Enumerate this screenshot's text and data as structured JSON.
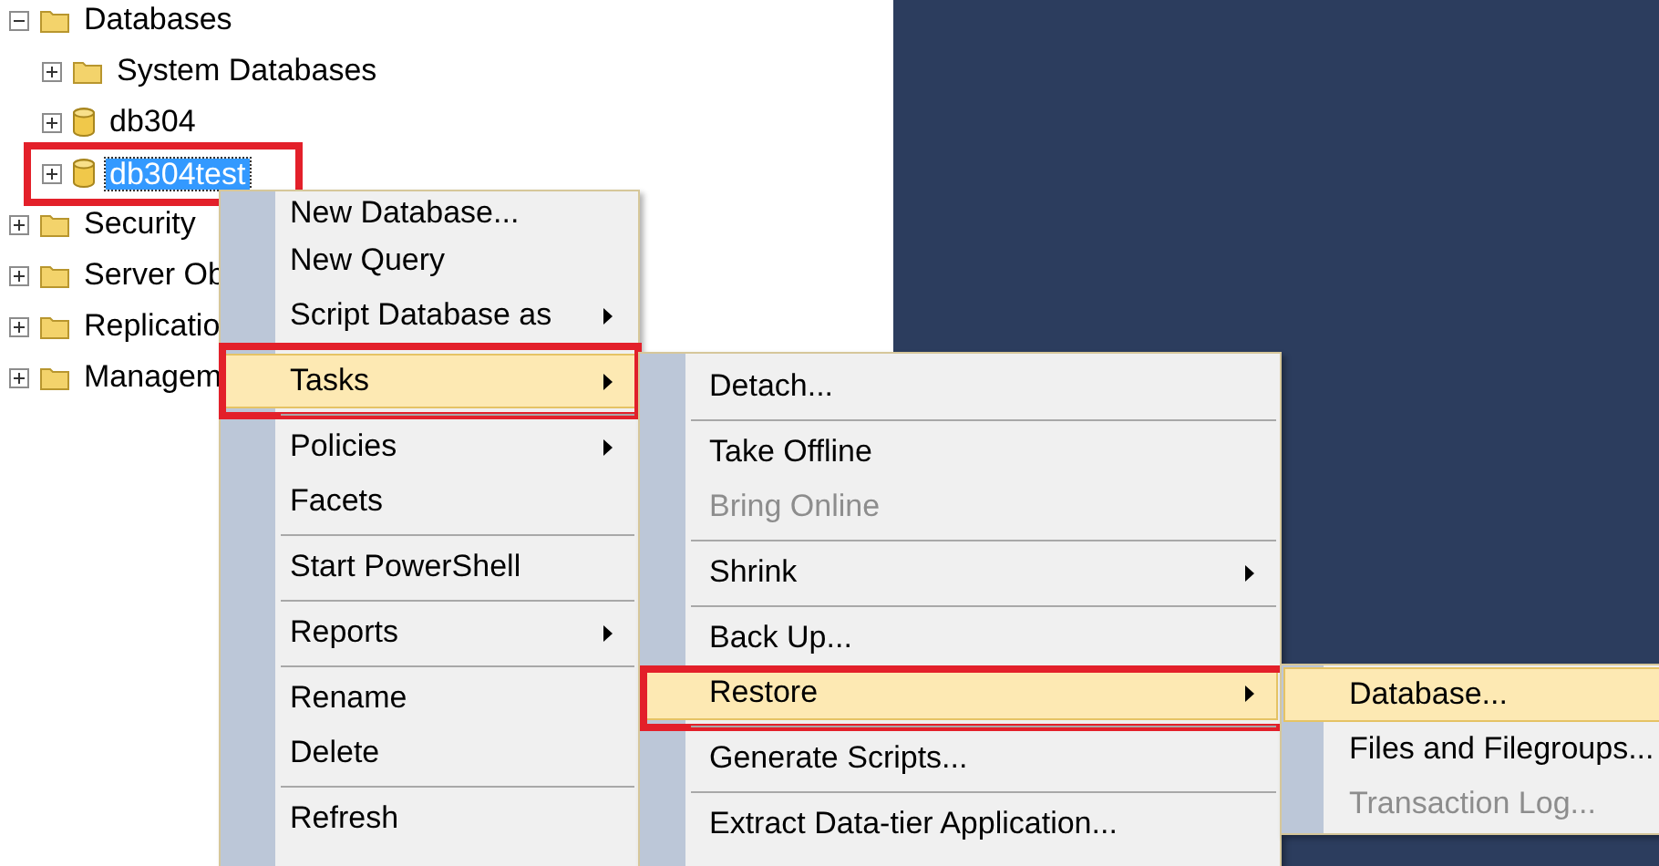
{
  "tree": [
    {
      "label": "Databases",
      "kind": "folder",
      "expanded": true,
      "selected": false,
      "annotated": false,
      "children": [
        {
          "label": "System Databases",
          "kind": "folder",
          "expanded": false,
          "selected": false,
          "annotated": false
        },
        {
          "label": "db304",
          "kind": "database",
          "expanded": false,
          "selected": false,
          "annotated": false
        },
        {
          "label": "db304test",
          "kind": "database",
          "expanded": false,
          "selected": true,
          "annotated": true
        }
      ]
    },
    {
      "label": "Security",
      "kind": "folder",
      "expanded": false,
      "selected": false,
      "annotated": false
    },
    {
      "label": "Server Ob",
      "kind": "folder",
      "expanded": false,
      "selected": false,
      "annotated": false
    },
    {
      "label": "Replicatio",
      "kind": "folder",
      "expanded": false,
      "selected": false,
      "annotated": false
    },
    {
      "label": "Managem",
      "kind": "folder",
      "expanded": false,
      "selected": false,
      "annotated": false
    }
  ],
  "menus": [
    {
      "items": [
        {
          "kind": "item",
          "label": "New Database...",
          "submenu": false,
          "selected": false,
          "disabled": false,
          "annotated": false
        },
        {
          "kind": "item",
          "label": "New Query",
          "submenu": false,
          "selected": false,
          "disabled": false,
          "annotated": false
        },
        {
          "kind": "item",
          "label": "Script Database as",
          "submenu": true,
          "selected": false,
          "disabled": false,
          "annotated": false
        },
        {
          "kind": "separator"
        },
        {
          "kind": "item",
          "label": "Tasks",
          "submenu": true,
          "selected": true,
          "disabled": false,
          "annotated": true
        },
        {
          "kind": "separator"
        },
        {
          "kind": "item",
          "label": "Policies",
          "submenu": true,
          "selected": false,
          "disabled": false,
          "annotated": false
        },
        {
          "kind": "item",
          "label": "Facets",
          "submenu": false,
          "selected": false,
          "disabled": false,
          "annotated": false
        },
        {
          "kind": "separator"
        },
        {
          "kind": "item",
          "label": "Start PowerShell",
          "submenu": false,
          "selected": false,
          "disabled": false,
          "annotated": false
        },
        {
          "kind": "separator"
        },
        {
          "kind": "item",
          "label": "Reports",
          "submenu": true,
          "selected": false,
          "disabled": false,
          "annotated": false
        },
        {
          "kind": "separator"
        },
        {
          "kind": "item",
          "label": "Rename",
          "submenu": false,
          "selected": false,
          "disabled": false,
          "annotated": false
        },
        {
          "kind": "item",
          "label": "Delete",
          "submenu": false,
          "selected": false,
          "disabled": false,
          "annotated": false
        },
        {
          "kind": "separator"
        },
        {
          "kind": "item",
          "label": "Refresh",
          "submenu": false,
          "selected": false,
          "disabled": false,
          "annotated": false
        }
      ]
    },
    {
      "items": [
        {
          "kind": "item",
          "label": "Detach...",
          "submenu": false,
          "selected": false,
          "disabled": false,
          "annotated": false
        },
        {
          "kind": "separator"
        },
        {
          "kind": "item",
          "label": "Take Offline",
          "submenu": false,
          "selected": false,
          "disabled": false,
          "annotated": false
        },
        {
          "kind": "item",
          "label": "Bring Online",
          "submenu": false,
          "selected": false,
          "disabled": true,
          "annotated": false
        },
        {
          "kind": "separator"
        },
        {
          "kind": "item",
          "label": "Shrink",
          "submenu": true,
          "selected": false,
          "disabled": false,
          "annotated": false
        },
        {
          "kind": "separator"
        },
        {
          "kind": "item",
          "label": "Back Up...",
          "submenu": false,
          "selected": false,
          "disabled": false,
          "annotated": false
        },
        {
          "kind": "item",
          "label": "Restore",
          "submenu": true,
          "selected": true,
          "disabled": false,
          "annotated": true
        },
        {
          "kind": "separator"
        },
        {
          "kind": "item",
          "label": "Generate Scripts...",
          "submenu": false,
          "selected": false,
          "disabled": false,
          "annotated": false
        },
        {
          "kind": "separator"
        },
        {
          "kind": "item",
          "label": "Extract Data-tier Application...",
          "submenu": false,
          "selected": false,
          "disabled": false,
          "annotated": false
        }
      ]
    },
    {
      "items": [
        {
          "kind": "item",
          "label": "Database...",
          "submenu": false,
          "selected": true,
          "disabled": false,
          "annotated": false
        },
        {
          "kind": "item",
          "label": "Files and Filegroups...",
          "submenu": false,
          "selected": false,
          "disabled": false,
          "annotated": false
        },
        {
          "kind": "item",
          "label": "Transaction Log...",
          "submenu": false,
          "selected": false,
          "disabled": true,
          "annotated": false
        }
      ]
    }
  ]
}
